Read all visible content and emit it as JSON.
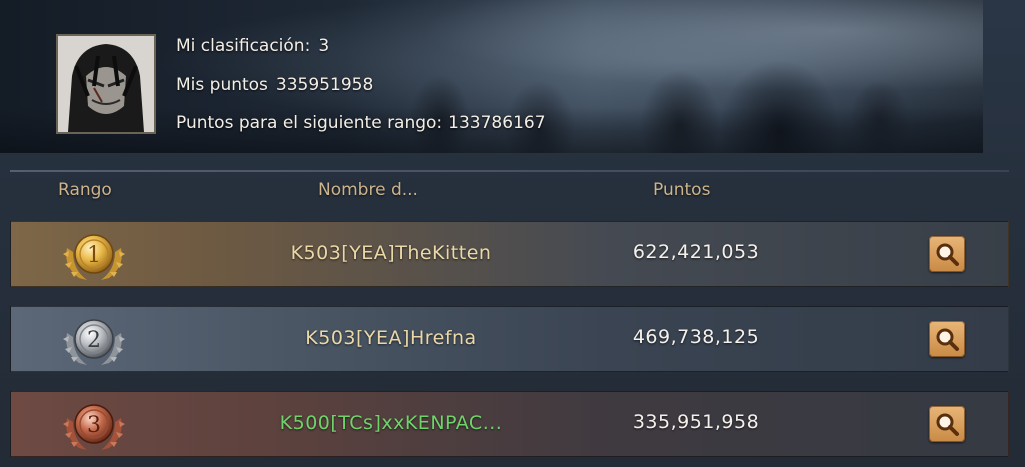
{
  "profile": {
    "rank_label": "Mi clasificación:",
    "rank_value": "3",
    "points_label": "Mis puntos",
    "points_value": "335951958",
    "next_label": "Puntos para el siguiente rango:",
    "next_value": "133786167"
  },
  "table": {
    "headers": {
      "rank": "Rango",
      "name": "Nombre d...",
      "points": "Puntos"
    },
    "rows": [
      {
        "rank": "1",
        "name": "K503[YEA]TheKitten",
        "points": "622,421,053",
        "medal": "gold-laurel-medal-icon"
      },
      {
        "rank": "2",
        "name": "K503[YEA]Hrefna",
        "points": "469,738,125",
        "medal": "silver-laurel-medal-icon"
      },
      {
        "rank": "3",
        "name": "K500[TCs]xxKENPAC...",
        "points": "335,951,958",
        "medal": "bronze-laurel-medal-icon"
      }
    ]
  },
  "colors": {
    "header_text": "#cdb48c",
    "name_text": "#ead8a9",
    "own_name_text": "#6ed46a",
    "search_button": "#d99a55"
  },
  "icons": {
    "search": "magnifier-icon"
  }
}
